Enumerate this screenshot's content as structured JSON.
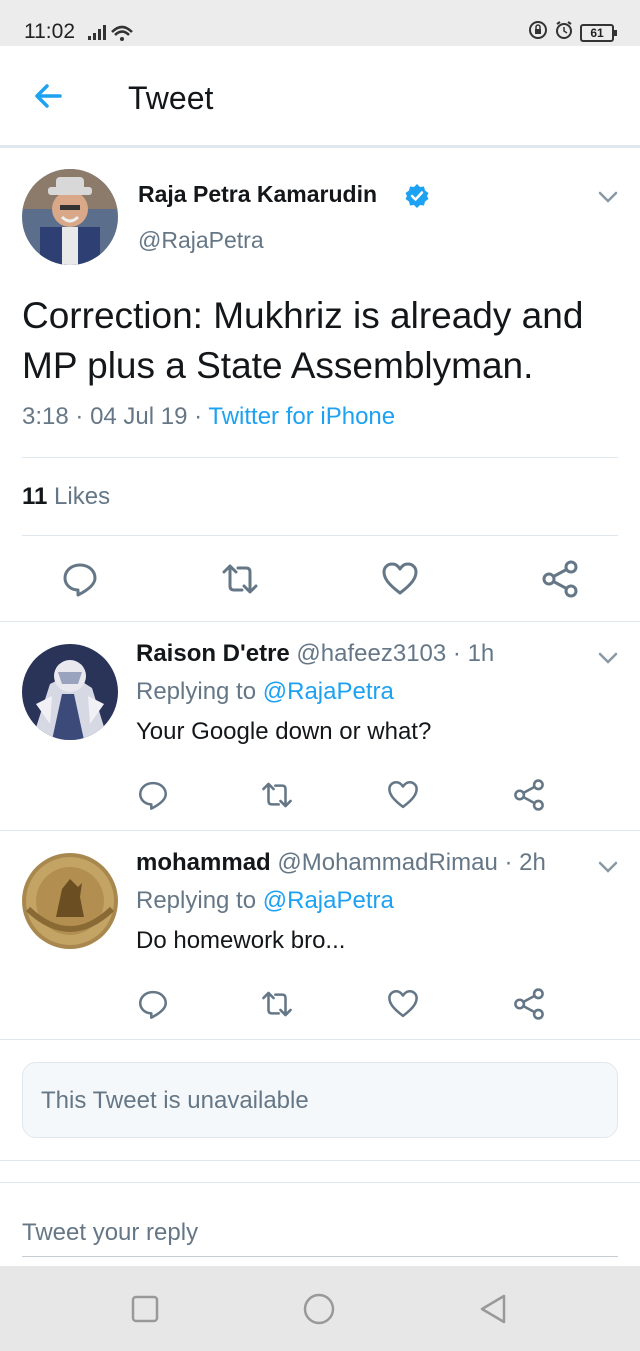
{
  "status_bar": {
    "time": "11:02",
    "battery": "61",
    "icons": [
      "signal-icon",
      "wifi-icon",
      "lock-rotation-icon",
      "alarm-icon",
      "battery-icon"
    ]
  },
  "header": {
    "title": "Tweet",
    "back_icon": "arrow-left-icon"
  },
  "tweet": {
    "author_name": "Raja Petra Kamarudin",
    "author_handle": "@RajaPetra",
    "verified": true,
    "text": "Correction: Mukhriz is already and MP plus a State Assemblyman.",
    "time": "3:18",
    "date": "04 Jul 19",
    "source": "Twitter for iPhone",
    "likes_count": "11",
    "likes_label": "Likes"
  },
  "replies": [
    {
      "name": "Raison D'etre",
      "handle": "@hafeez3103",
      "age": "1h",
      "replying_label": "Replying to",
      "replying_to": "@RajaPetra",
      "text": "Your Google down or what?"
    },
    {
      "name": "mohammad",
      "handle": "@MohammadRimau",
      "age": "2h",
      "replying_label": "Replying to",
      "replying_to": "@RajaPetra",
      "text": "Do homework bro..."
    }
  ],
  "unavailable_text": "This Tweet is unavailable",
  "reply_box": {
    "placeholder": "Tweet your reply"
  },
  "colors": {
    "accent": "#1da1f2",
    "secondary_text": "#657786",
    "primary_text": "#14171a",
    "divider": "#e1e8ed"
  }
}
